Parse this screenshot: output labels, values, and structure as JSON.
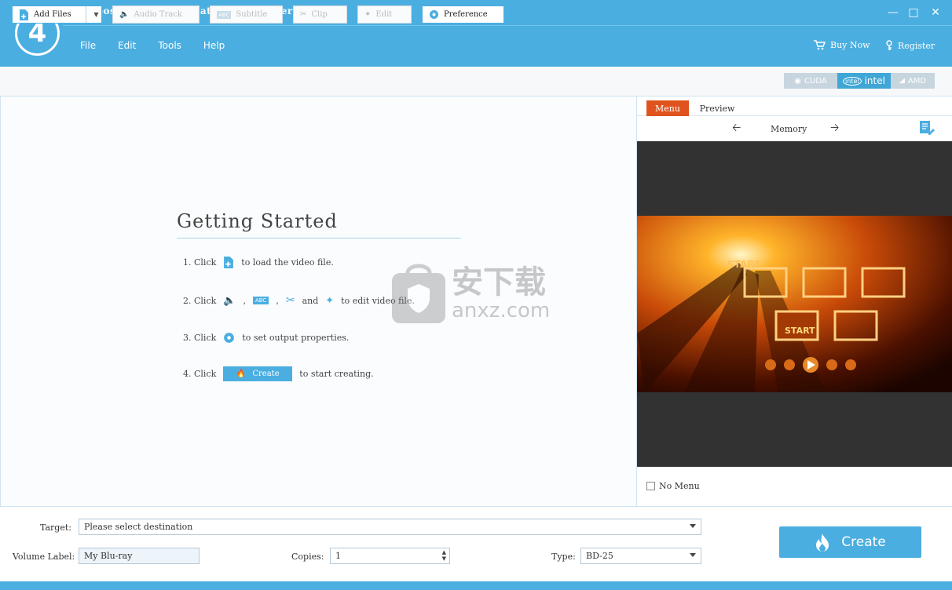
{
  "app": {
    "title": "4Videosoft Blu-ray Creator (Unregistered)",
    "logo_text": "4",
    "menu": [
      "File",
      "Edit",
      "Tools",
      "Help"
    ],
    "buy_now": "Buy Now",
    "register": "Register"
  },
  "toolbar": {
    "add_files": "Add Files",
    "audio_track": "Audio Track",
    "subtitle": "Subtitle",
    "clip": "Clip",
    "edit": "Edit",
    "preference": "Preference",
    "accel": [
      "CUDA",
      "intel",
      "AMD"
    ]
  },
  "getting_started": {
    "title": "Getting Started",
    "step1_num": "1. Click",
    "step1_text": "to load the video file.",
    "step2_num": "2. Click",
    "step2_sep1": ",",
    "step2_sep2": ",",
    "step2_and": "and",
    "step2_text": "to edit video file.",
    "step3_num": "3. Click",
    "step3_text": "to set output properties.",
    "step4_num": "4. Click",
    "step4_button": "Create",
    "step4_text": "to start creating."
  },
  "watermark": {
    "cn": "安下载",
    "en": "anxz.com"
  },
  "menu_panel": {
    "tabs": [
      "Menu",
      "Preview"
    ],
    "template_name": "Memory",
    "no_menu": "No Menu",
    "menu_start_label": "START"
  },
  "bottom": {
    "target_label": "Target:",
    "target_value": "Please select destination",
    "volume_label": "Volume Label:",
    "volume_value": "My Blu-ray",
    "copies_label": "Copies:",
    "copies_value": "1",
    "type_label": "Type:",
    "type_value": "BD-25",
    "create": "Create"
  },
  "colors": {
    "accent": "#4aaee0",
    "tab_active": "#e0531e"
  }
}
